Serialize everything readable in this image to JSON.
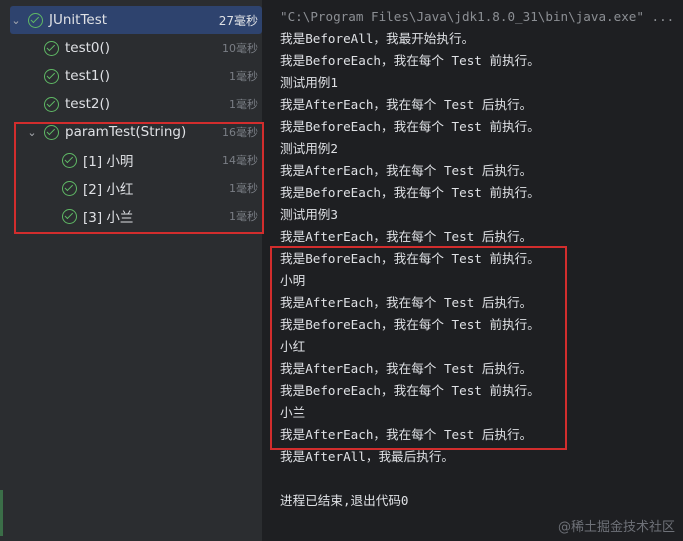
{
  "tree": {
    "root": {
      "label": "JUnitTest",
      "time": "27毫秒"
    },
    "items": [
      {
        "label": "test0()",
        "time": "10毫秒"
      },
      {
        "label": "test1()",
        "time": "1毫秒"
      },
      {
        "label": "test2()",
        "time": "1毫秒"
      }
    ],
    "param": {
      "label": "paramTest(String)",
      "time": "16毫秒"
    },
    "param_items": [
      {
        "label": "[1] 小明",
        "time": "14毫秒"
      },
      {
        "label": "[2] 小红",
        "time": "1毫秒"
      },
      {
        "label": "[3] 小兰",
        "time": "1毫秒"
      }
    ]
  },
  "console": {
    "command": "\"C:\\Program Files\\Java\\jdk1.8.0_31\\bin\\java.exe\" ...",
    "lines": [
      "我是BeforeAll，我最开始执行。",
      "我是BeforeEach，我在每个 Test 前执行。",
      "测试用例1",
      "我是AfterEach，我在每个 Test 后执行。",
      "我是BeforeEach，我在每个 Test 前执行。",
      "测试用例2",
      "我是AfterEach，我在每个 Test 后执行。",
      "我是BeforeEach，我在每个 Test 前执行。",
      "测试用例3",
      "我是AfterEach，我在每个 Test 后执行。",
      "我是BeforeEach，我在每个 Test 前执行。",
      "小明",
      "我是AfterEach，我在每个 Test 后执行。",
      "我是BeforeEach，我在每个 Test 前执行。",
      "小红",
      "我是AfterEach，我在每个 Test 后执行。",
      "我是BeforeEach，我在每个 Test 前执行。",
      "小兰",
      "我是AfterEach，我在每个 Test 后执行。",
      "我是AfterAll，我最后执行。",
      "",
      "进程已结束,退出代码0"
    ]
  },
  "watermark": "@稀土掘金技术社区",
  "colors": {
    "pass": "#5fb865",
    "highlight": "#d22d2d",
    "selection": "#2e436e"
  }
}
